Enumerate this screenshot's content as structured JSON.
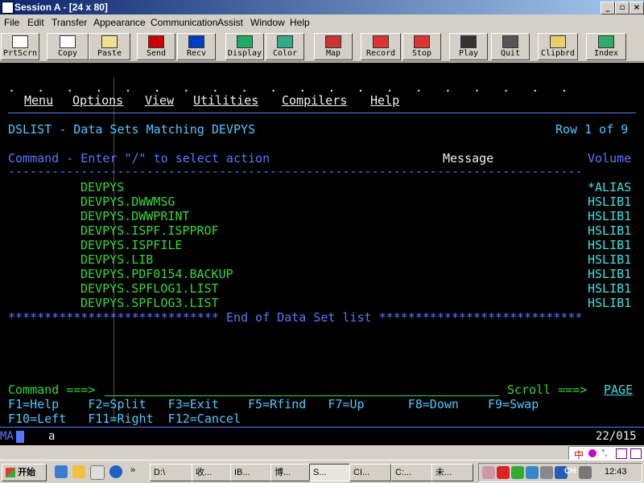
{
  "window": {
    "title": "Session A - [24 x 80]"
  },
  "menubar": [
    "File",
    "Edit",
    "Transfer",
    "Appearance",
    "Communication",
    "Assist",
    "Window",
    "Help"
  ],
  "toolbar": [
    {
      "label": "PrtScrn",
      "icon": "print-screen-icon"
    },
    {
      "label": "Copy",
      "icon": "copy-icon"
    },
    {
      "label": "Paste",
      "icon": "paste-icon"
    },
    {
      "label": "Send",
      "icon": "send-icon"
    },
    {
      "label": "Recv",
      "icon": "receive-icon"
    },
    {
      "label": "Display",
      "icon": "display-icon"
    },
    {
      "label": "Color",
      "icon": "color-icon"
    },
    {
      "label": "Map",
      "icon": "map-icon"
    },
    {
      "label": "Record",
      "icon": "record-icon"
    },
    {
      "label": "Stop",
      "icon": "stop-icon"
    },
    {
      "label": "Play",
      "icon": "play-icon"
    },
    {
      "label": "Quit",
      "icon": "quit-icon"
    },
    {
      "label": "Clipbrd",
      "icon": "clipboard-icon"
    },
    {
      "label": "Index",
      "icon": "index-icon"
    }
  ],
  "terminal": {
    "dots": ".   .   .   .   .   .   .   .   .   .   .   .   .   .   .   .   .   .   .   .",
    "ispf_menu": [
      "Menu",
      "Options",
      "View",
      "Utilities",
      "Compilers",
      "Help"
    ],
    "panel_title": "DSLIST - Data Sets Matching DEVPYS",
    "row_info": "Row 1 of 9",
    "column_header": {
      "command": "Command - Enter \"/\" to select action",
      "message": "Message",
      "volume": "Volume"
    },
    "separator": "-------------------------------------------------------------------------------",
    "datasets": [
      {
        "name": "DEVPYS",
        "volume": "*ALIAS"
      },
      {
        "name": "DEVPYS.DWWMSG",
        "volume": "HSLIB1"
      },
      {
        "name": "DEVPYS.DWWPRINT",
        "volume": "HSLIB1"
      },
      {
        "name": "DEVPYS.ISPF.ISPPROF",
        "volume": "HSLIB1"
      },
      {
        "name": "DEVPYS.ISPFILE",
        "volume": "HSLIB1"
      },
      {
        "name": "DEVPYS.LIB",
        "volume": "HSLIB1"
      },
      {
        "name": "DEVPYS.PDF0154.BACKUP",
        "volume": "HSLIB1"
      },
      {
        "name": "DEVPYS.SPFLOG1.LIST",
        "volume": "HSLIB1"
      },
      {
        "name": "DEVPYS.SPFLOG3.LIST",
        "volume": "HSLIB1"
      }
    ],
    "end_line": "***************************** End of Data Set list ****************************",
    "command_prompt": "Command ===>",
    "scroll_prompt": "Scroll ===>",
    "scroll_value": "PAGE",
    "fkeys_row1": "F1=Help    F2=Split   F3=Exit    F5=Rfind   F7=Up      F8=Down    F9=Swap",
    "fkeys_row2": "F10=Left   F11=Right  F12=Cancel"
  },
  "status": {
    "left": "MA",
    "mode": "a",
    "position": "22/015"
  },
  "taskbar": {
    "start": "开始",
    "tasks": [
      "D:\\",
      "收...",
      "IB...",
      "博...",
      "S...",
      "CI...",
      "C:...",
      "未..."
    ],
    "clock": "12:43",
    "ime": "CH"
  }
}
